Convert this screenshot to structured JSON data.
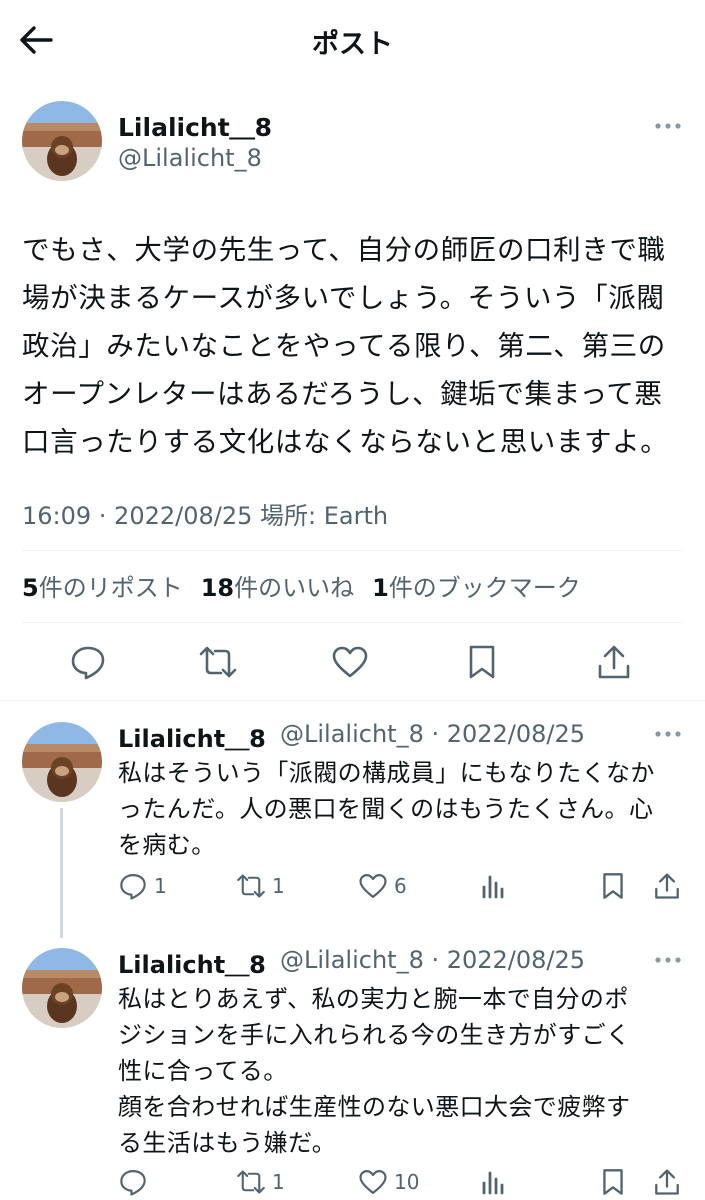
{
  "header": {
    "title": "ポスト"
  },
  "post": {
    "display_name": "Lilalicht＿8",
    "handle": "@Lilalicht_8",
    "text": "でもさ、大学の先生って、自分の師匠の口利きで職\n場が決まるケースが多いでしょう。そういう「派閥\n政治」みたいなことをやってる限り、第二、第三の\nオープンレターはあるだろうし、鍵垢で集まって悪\n口言ったりする文化はなくならないと思いますよ。",
    "meta": "16:09 · 2022/08/25 場所: Earth",
    "reposts_count": "5",
    "reposts_label": "件のリポスト",
    "likes_count": "18",
    "likes_label": "件のいいね",
    "bookmarks_count": "1",
    "bookmarks_label": "件のブックマーク"
  },
  "replies": [
    {
      "display_name": "Lilalicht＿8",
      "handle": "@Lilalicht_8 · 2022/08/25",
      "text": "私はそういう「派閥の構成員」にもなりたくなか\nったんだ。人の悪口を聞くのはもうたくさん。心\nを病む。",
      "reply_count": "1",
      "repost_count": "1",
      "like_count": "6"
    },
    {
      "display_name": "Lilalicht＿8",
      "handle": "@Lilalicht_8 · 2022/08/25",
      "text": "私はとりあえず、私の実力と腕一本で自分のポ\nジションを手に入れられる今の生き方がすごく\n性に合ってる。\n顔を合わせれば生産性のない悪口大会で疲弊す\nる生活はもう嫌だ。",
      "reply_count": "",
      "repost_count": "1",
      "like_count": "10"
    }
  ],
  "colors": {
    "text": "#0f1419",
    "secondary": "#536471",
    "divider": "#eff3f4"
  }
}
